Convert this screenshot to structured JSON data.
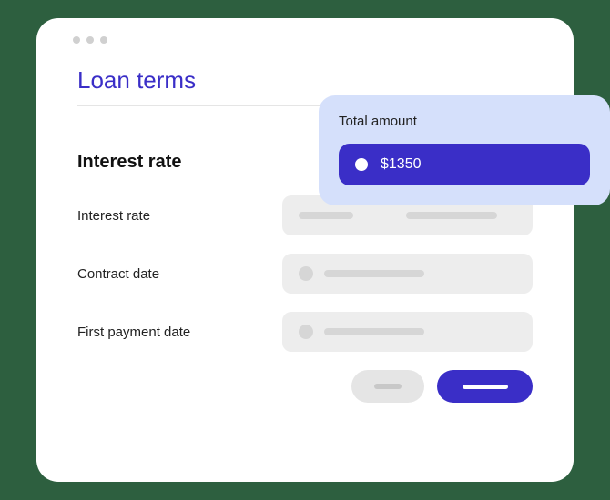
{
  "page": {
    "title": "Loan terms"
  },
  "total": {
    "label": "Total amount",
    "value": "$1350"
  },
  "section": {
    "title": "Interest rate"
  },
  "fields": {
    "interest_rate": {
      "label": "Interest rate"
    },
    "contract_date": {
      "label": "Contract date"
    },
    "first_payment_date": {
      "label": "First payment date"
    }
  }
}
